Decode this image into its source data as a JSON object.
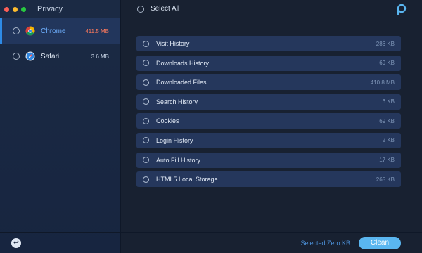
{
  "sidebar": {
    "title": "Privacy",
    "browsers": [
      {
        "name": "Chrome",
        "size": "411.5 MB",
        "selected": true,
        "icon": "chrome-icon"
      },
      {
        "name": "Safari",
        "size": "3.6 MB",
        "selected": false,
        "icon": "safari-icon"
      }
    ],
    "footer_icon": "back-arrow-icon"
  },
  "header": {
    "select_all_label": "Select All",
    "logo_icon": "app-logo-icon"
  },
  "items": [
    {
      "label": "Visit History",
      "size": "286 KB"
    },
    {
      "label": "Downloads History",
      "size": "69 KB"
    },
    {
      "label": "Downloaded Files",
      "size": "410.8 MB"
    },
    {
      "label": "Search History",
      "size": "6 KB"
    },
    {
      "label": "Cookies",
      "size": "69 KB"
    },
    {
      "label": "Login History",
      "size": "2 KB"
    },
    {
      "label": "Auto Fill History",
      "size": "17 KB"
    },
    {
      "label": "HTML5 Local Storage",
      "size": "265 KB"
    }
  ],
  "footer": {
    "selected_text": "Selected Zero KB",
    "clean_label": "Clean"
  },
  "colors": {
    "accent": "#5ab6f0",
    "alert": "#ff7a5c",
    "sidebar_bg": "#1b2a44",
    "row_bg": "#25375c"
  }
}
